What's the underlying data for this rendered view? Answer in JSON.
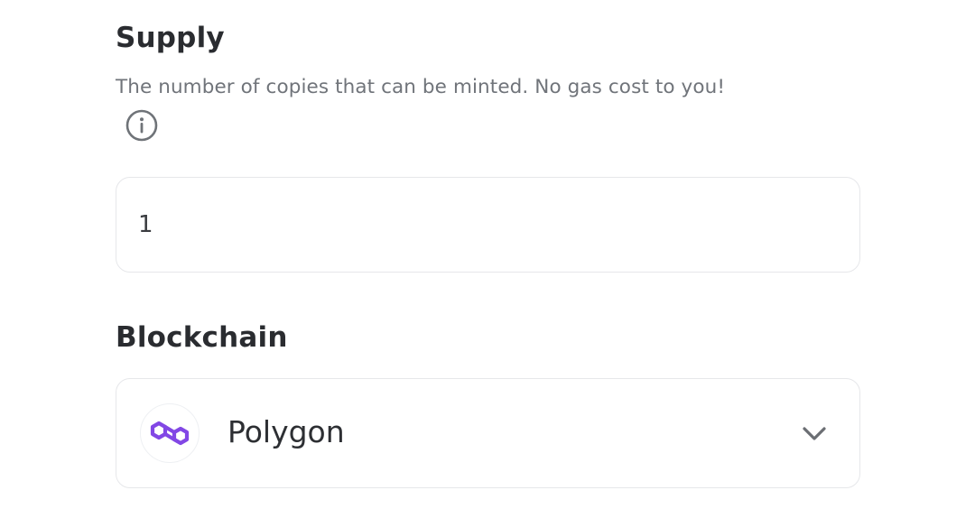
{
  "supply": {
    "title": "Supply",
    "help_text": "The number of copies that can be minted. No gas cost to you!",
    "info_icon": "info-circle-icon",
    "value": "1"
  },
  "blockchain": {
    "title": "Blockchain",
    "selected": "Polygon",
    "logo_icon": "polygon-logo-icon",
    "dropdown_icon": "chevron-down-icon"
  },
  "colors": {
    "heading": "#2a2c30",
    "help_text": "#70747a",
    "border": "#e6e7ea",
    "polygon_purple": "#8247e5",
    "chevron": "#6b6e73"
  }
}
